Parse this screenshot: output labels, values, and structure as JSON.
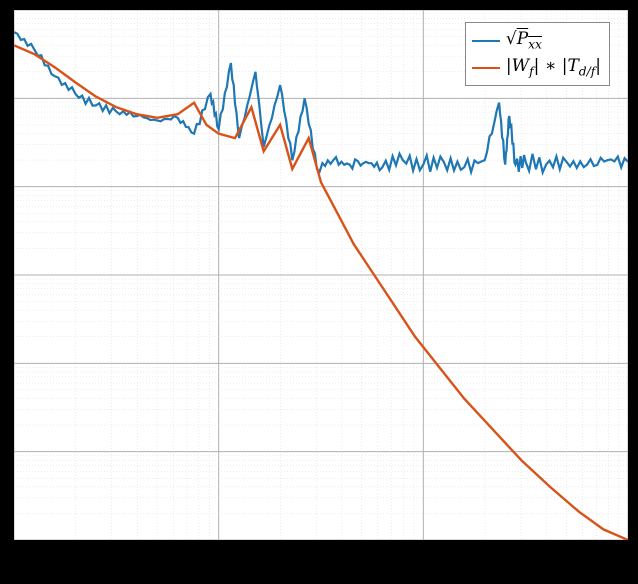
{
  "chart_data": {
    "type": "line",
    "axes": {
      "xscale": "log",
      "yscale": "log"
    },
    "x_decades_shown": 3,
    "y_decades_shown": 6,
    "grid": {
      "major": true,
      "minor": true,
      "style": "dotted"
    },
    "legend": {
      "position": "top-right",
      "entries": [
        {
          "name": "sqrt_Pxx",
          "label_tex": "\\sqrt{P_{xx}}",
          "color": "#1f77b4"
        },
        {
          "name": "Wf_Tdf",
          "label_tex": "|W_f|*|T_{d/f}|",
          "color": "#d95319"
        }
      ]
    },
    "series": [
      {
        "name": "sqrt_Pxx",
        "color": "#1f77b4",
        "description": "Measured amplitude spectrum (noisy). Decreases ~1 decade over first x-decade, shows 3–4 resonance peaks mid-band, then flattens to a noise floor ~1.5 decades below start with narrow spikes.",
        "approx_points_log": [
          [
            0.0,
            5.75
          ],
          [
            0.1,
            5.55
          ],
          [
            0.2,
            5.25
          ],
          [
            0.3,
            5.05
          ],
          [
            0.4,
            4.92
          ],
          [
            0.5,
            4.85
          ],
          [
            0.6,
            4.8
          ],
          [
            0.7,
            4.75
          ],
          [
            0.8,
            4.78
          ],
          [
            0.88,
            4.6
          ],
          [
            0.96,
            5.05
          ],
          [
            1.0,
            4.65
          ],
          [
            1.06,
            5.4
          ],
          [
            1.1,
            4.55
          ],
          [
            1.18,
            5.3
          ],
          [
            1.22,
            4.45
          ],
          [
            1.3,
            5.15
          ],
          [
            1.36,
            4.3
          ],
          [
            1.42,
            5.0
          ],
          [
            1.48,
            4.2
          ],
          [
            1.56,
            4.3
          ],
          [
            1.64,
            4.25
          ],
          [
            1.72,
            4.28
          ],
          [
            1.8,
            4.22
          ],
          [
            1.9,
            4.3
          ],
          [
            2.0,
            4.25
          ],
          [
            2.1,
            4.28
          ],
          [
            2.2,
            4.22
          ],
          [
            2.3,
            4.3
          ],
          [
            2.37,
            4.95
          ],
          [
            2.4,
            4.25
          ],
          [
            2.42,
            4.8
          ],
          [
            2.45,
            4.25
          ],
          [
            2.5,
            4.28
          ],
          [
            2.6,
            4.25
          ],
          [
            2.7,
            4.28
          ],
          [
            2.8,
            4.25
          ],
          [
            2.9,
            4.3
          ],
          [
            3.0,
            4.28
          ]
        ]
      },
      {
        "name": "Wf_Tdf",
        "color": "#d95319",
        "description": "Model/weighted transfer magnitude. Smooth roll-off matching blue over first decade, small resonance bumps near x-decade 1–1.5, then steep monotone roll-off to bottom-right corner (~5 decades drop over last 1.5 x-decades).",
        "approx_points_log": [
          [
            0.0,
            5.6
          ],
          [
            0.1,
            5.5
          ],
          [
            0.2,
            5.35
          ],
          [
            0.3,
            5.18
          ],
          [
            0.4,
            5.02
          ],
          [
            0.5,
            4.9
          ],
          [
            0.6,
            4.82
          ],
          [
            0.7,
            4.78
          ],
          [
            0.8,
            4.82
          ],
          [
            0.88,
            4.95
          ],
          [
            0.94,
            4.7
          ],
          [
            1.0,
            4.6
          ],
          [
            1.08,
            4.55
          ],
          [
            1.16,
            4.9
          ],
          [
            1.22,
            4.4
          ],
          [
            1.3,
            4.7
          ],
          [
            1.36,
            4.2
          ],
          [
            1.44,
            4.55
          ],
          [
            1.5,
            4.05
          ],
          [
            1.58,
            3.7
          ],
          [
            1.66,
            3.35
          ],
          [
            1.76,
            3.0
          ],
          [
            1.86,
            2.65
          ],
          [
            1.96,
            2.3
          ],
          [
            2.08,
            1.95
          ],
          [
            2.2,
            1.6
          ],
          [
            2.34,
            1.25
          ],
          [
            2.48,
            0.9
          ],
          [
            2.62,
            0.6
          ],
          [
            2.76,
            0.32
          ],
          [
            2.88,
            0.12
          ],
          [
            3.0,
            0.0
          ]
        ]
      }
    ]
  },
  "legend_text": {
    "row1_html": "&radic;<span style='text-decoration:overline; font-style:italic;'>P<sub>xx</sub></span>",
    "row2_html": "|<i>W<sub>f</sub></i>|&nbsp;&lowast;&nbsp;|<i>T<sub>d/f</sub></i>|"
  }
}
